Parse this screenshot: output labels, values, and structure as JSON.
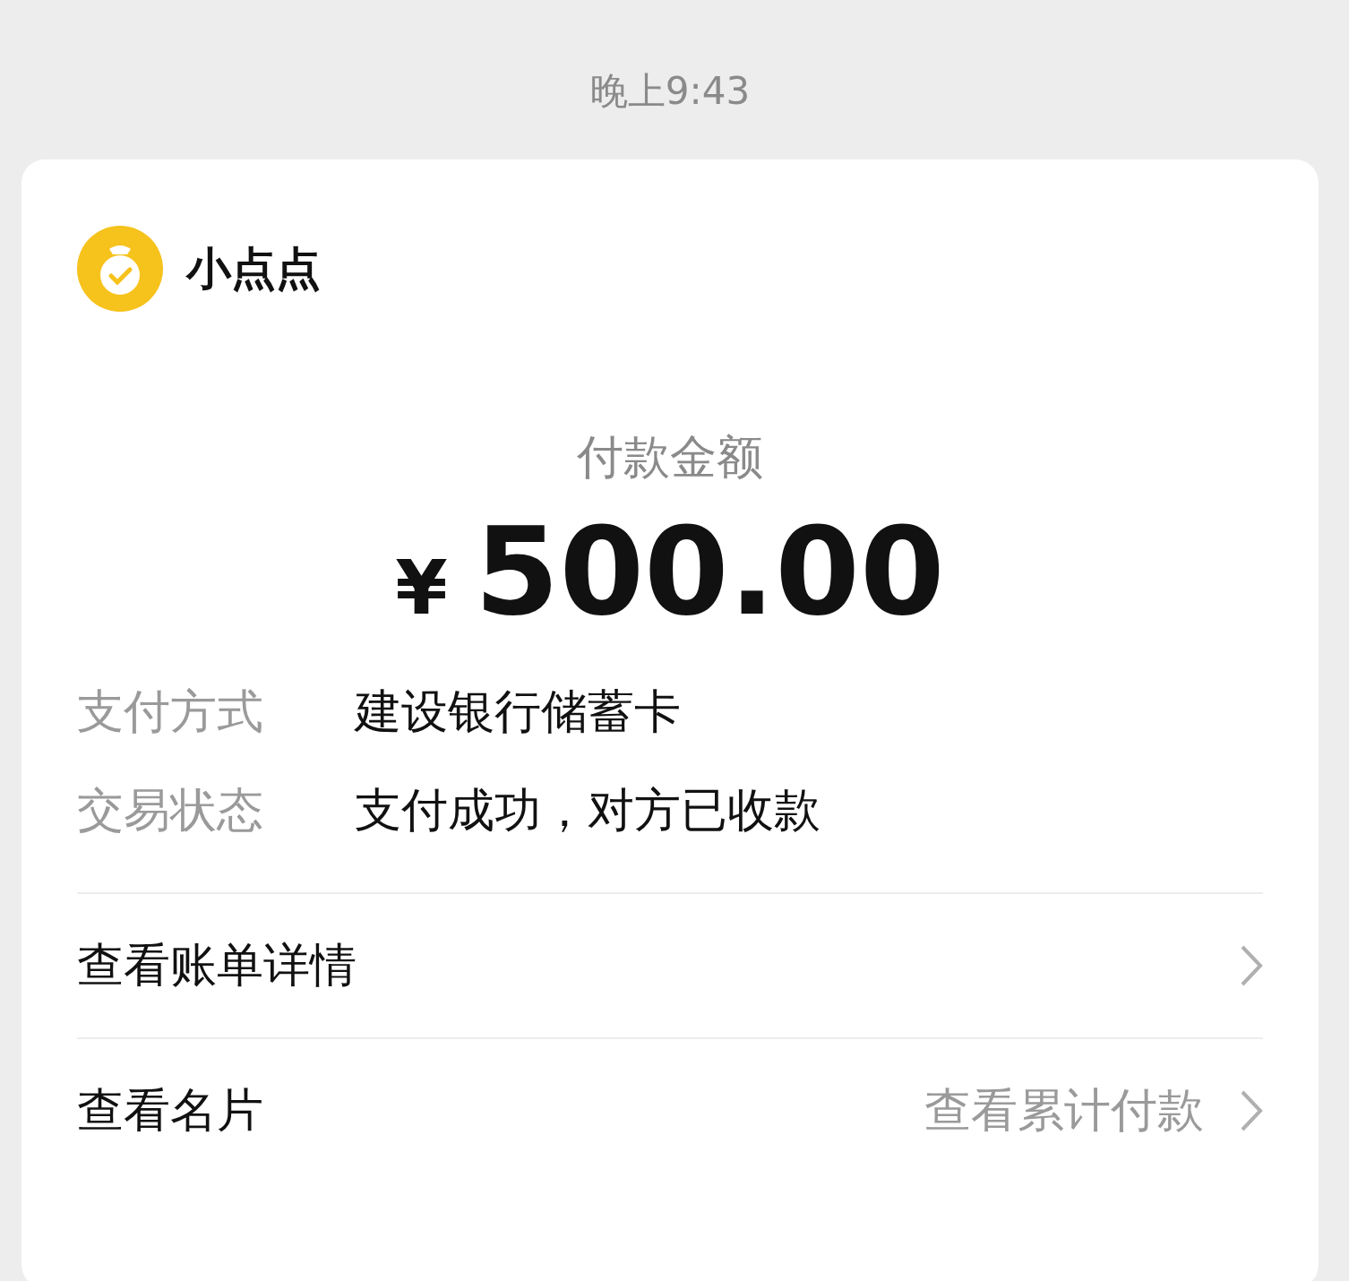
{
  "time": "晚上9:43",
  "merchant": {
    "name": "小点点"
  },
  "amount_label": "付款金额",
  "amount": {
    "currency": "¥",
    "value": "500.00"
  },
  "details": [
    {
      "label": "支付方式",
      "value": "建设银行储蓄卡"
    },
    {
      "label": "交易状态",
      "value": "支付成功，对方已收款"
    }
  ],
  "links": [
    {
      "label": "查看账单详情"
    },
    {
      "label": "查看名片",
      "secondary": "查看累计付款"
    }
  ]
}
